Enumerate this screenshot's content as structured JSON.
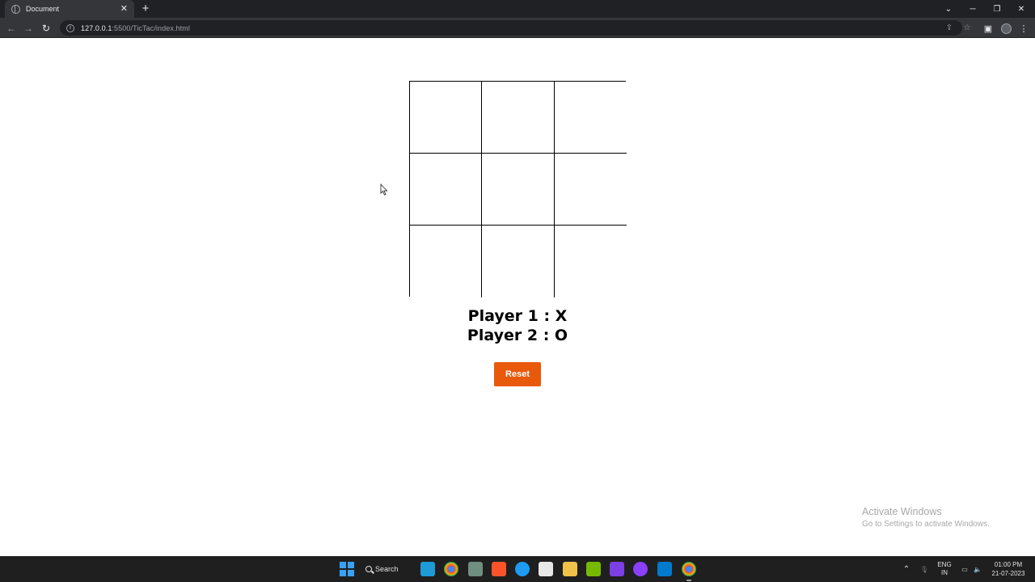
{
  "browser": {
    "tab_title": "Document",
    "tab_close": "✕",
    "new_tab": "+",
    "url_host": "127.0.0.1",
    "url_path": ":5500/TicTac/index.html"
  },
  "game": {
    "player1": "Player 1 : X",
    "player2": "Player 2 : O",
    "reset_label": "Reset",
    "cells": [
      "",
      "",
      "",
      "",
      "",
      "",
      "",
      "",
      ""
    ]
  },
  "watermark": {
    "line1": "Activate Windows",
    "line2": "Go to Settings to activate Windows."
  },
  "taskbar": {
    "search_label": "Search",
    "lang_line1": "ENG",
    "lang_line2": "IN",
    "time": "01:00 PM",
    "date": "21-07-2023"
  },
  "colors": {
    "reset_button": "#e8590c",
    "windows_accent": "#3aa0f3"
  }
}
